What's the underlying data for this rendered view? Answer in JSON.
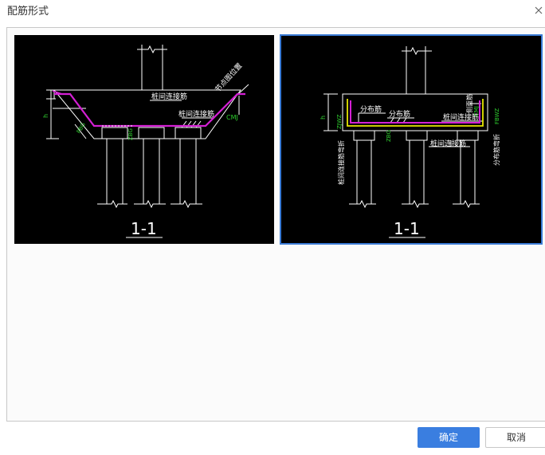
{
  "dialog": {
    "title": "配筋形式",
    "close_icon": "close-icon"
  },
  "options": [
    {
      "section_label": "1-1",
      "labels": {
        "rebar_a": "桩间连接筋",
        "rebar_b": "桩间连接筋",
        "slope": "节点图位置",
        "code_a": "CMJ",
        "code_b": "ZBG",
        "code_c": "PBG",
        "dim": "h"
      }
    },
    {
      "section_label": "1-1",
      "labels": {
        "dist_a": "分布筋",
        "dist_b": "分布筋",
        "rebar_top": "桩间连接筋",
        "rebar_bottom": "桩间连接筋",
        "left_vert": "桩间连接筋弯折",
        "right_vert": "分布筋弯折",
        "side": "侧面筋",
        "code_a": "ZJWZ",
        "code_b": "ZBG",
        "code_c": "CMJ",
        "code_d": "FBWZ",
        "dim": "h"
      }
    }
  ],
  "buttons": {
    "ok": "确定",
    "cancel": "取消"
  },
  "colors": {
    "accent": "#3a7ee0",
    "selected_border": "#3a7bd5",
    "rebar": "#d41fd4",
    "code_text": "#2ecc2e",
    "yellow_rebar": "#e6e600"
  }
}
